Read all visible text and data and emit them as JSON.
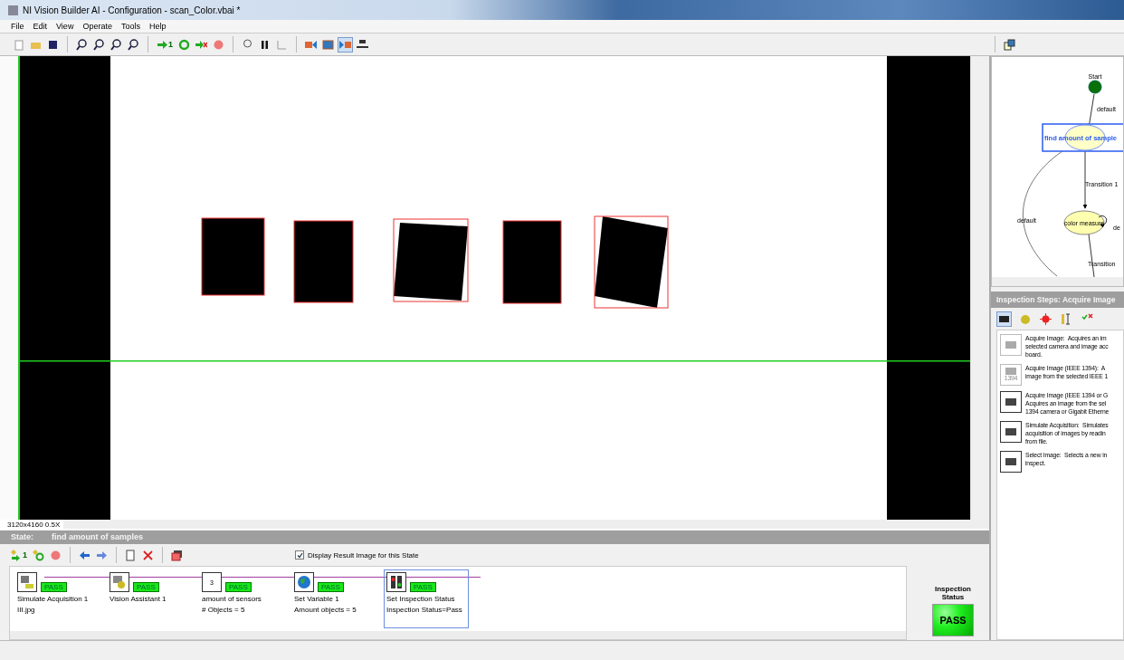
{
  "window": {
    "title": "NI Vision Builder AI - Configuration - scan_Color.vbai *"
  },
  "menu": [
    "File",
    "Edit",
    "View",
    "Operate",
    "Tools",
    "Help"
  ],
  "toolbar": {
    "run_once_label": "1"
  },
  "image_view": {
    "info": "3120x4160 0.5X"
  },
  "state": {
    "label": "State:",
    "name": "find amount of samples"
  },
  "step_toolbar": {
    "run_once_label": "1",
    "display_result": {
      "label": "Display Result Image for this State",
      "checked": true
    }
  },
  "steps": [
    {
      "kind": "simulate",
      "name": "Simulate Acquisition 1",
      "result": "III.jpg",
      "status": "PASS",
      "selected": false
    },
    {
      "kind": "assistant",
      "name": "Vision Assistant 1",
      "status": "PASS",
      "selected": false
    },
    {
      "kind": "sensors",
      "icon_text": "3",
      "name": "amount of sensors",
      "result": "# Objects = 5",
      "status": "PASS",
      "selected": false
    },
    {
      "kind": "globe",
      "name": "Set Variable 1",
      "result": "Amount objects = 5",
      "status": "PASS",
      "selected": false
    },
    {
      "kind": "lights",
      "name": "Set Inspection Status",
      "result": "Inspection Status=Pass",
      "status": "PASS",
      "selected": true
    }
  ],
  "inspection_status": {
    "label": "Inspection Status",
    "value": "PASS"
  },
  "diagram": {
    "start": "Start",
    "nodes": [
      "find amount of sample",
      "color measure"
    ],
    "transitions": [
      "default",
      "Transition 1",
      "default",
      "de",
      "Transition"
    ]
  },
  "inspection_steps": {
    "title": "Inspection Steps: Acquire Image",
    "items": [
      {
        "kind": "acquire",
        "lines": [
          "Acquire Image:  Acquires an im",
          "selected camera and image acc",
          "board."
        ]
      },
      {
        "kind": "ieee",
        "icon_text": "1394",
        "lines": [
          "Acquire Image (IEEE 1394):  A",
          "image from the selected IEEE 1"
        ]
      },
      {
        "kind": "gige",
        "lines": [
          "Acquire Image (IEEE 1394 or G",
          "Acquires an image from the sel",
          "1394 camera or Gigabit Etherne"
        ]
      },
      {
        "kind": "simulate",
        "lines": [
          "Simulate Acquisition:  Simulates",
          "acquisition of images by readin",
          "from file."
        ]
      },
      {
        "kind": "select",
        "lines": [
          "Select Image:  Selects a new in",
          "inspect."
        ]
      }
    ]
  }
}
